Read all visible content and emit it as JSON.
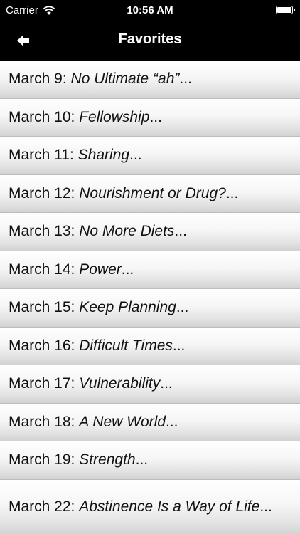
{
  "status_bar": {
    "carrier": "Carrier",
    "time": "10:56 AM",
    "wifi_icon": "wifi-icon",
    "battery_icon": "battery-icon"
  },
  "nav": {
    "title": "Favorites",
    "back_icon": "arrow-left-icon"
  },
  "items": [
    {
      "date": "March 9: ",
      "title": "No Ultimate “ah”",
      "ellipsis": "..."
    },
    {
      "date": "March 10: ",
      "title": "Fellowship",
      "ellipsis": "..."
    },
    {
      "date": "March 11: ",
      "title": "Sharing",
      "ellipsis": "..."
    },
    {
      "date": "March 12: ",
      "title": "Nourishment or Drug?",
      "ellipsis": "..."
    },
    {
      "date": "March 13: ",
      "title": "No More Diets",
      "ellipsis": "..."
    },
    {
      "date": "March 14: ",
      "title": "Power",
      "ellipsis": "..."
    },
    {
      "date": "March 15: ",
      "title": "Keep Planning",
      "ellipsis": "..."
    },
    {
      "date": "March 16: ",
      "title": "Difficult Times",
      "ellipsis": "..."
    },
    {
      "date": "March 17: ",
      "title": "Vulnerability",
      "ellipsis": "..."
    },
    {
      "date": "March 18: ",
      "title": "A New World",
      "ellipsis": "..."
    },
    {
      "date": "March 19: ",
      "title": "Strength",
      "ellipsis": "..."
    },
    {
      "date": "March 22: ",
      "title": "Abstinence Is a Way of Life",
      "ellipsis": "..."
    }
  ]
}
